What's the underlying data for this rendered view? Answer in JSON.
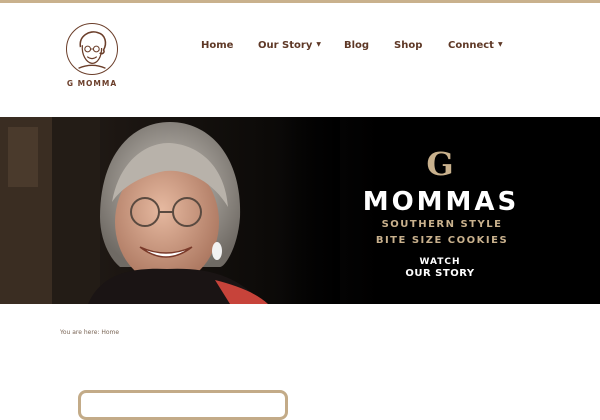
{
  "colors": {
    "accent": "#c9b18d",
    "brand_brown": "#6b3e2a",
    "nav_text": "#5e3826",
    "hero_bg": "#000000"
  },
  "logo": {
    "text": "G MOMMA",
    "icon": "grandma-portrait-icon"
  },
  "nav": {
    "items": [
      {
        "label": "Home",
        "dropdown": false
      },
      {
        "label": "Our Story",
        "dropdown": true
      },
      {
        "label": "Blog",
        "dropdown": false
      },
      {
        "label": "Shop",
        "dropdown": false
      },
      {
        "label": "Connect",
        "dropdown": true
      }
    ],
    "caret": "▼"
  },
  "hero": {
    "brand_letter": "G",
    "brand_name": "MOMMAS",
    "tagline_line1": "SOUTHERN STYLE",
    "tagline_line2": "BITE SIZE COOKIES",
    "watch_line1": "WATCH",
    "watch_line2": "OUR STORY"
  },
  "breadcrumb": {
    "prefix": "You are here:",
    "current": "Home"
  }
}
